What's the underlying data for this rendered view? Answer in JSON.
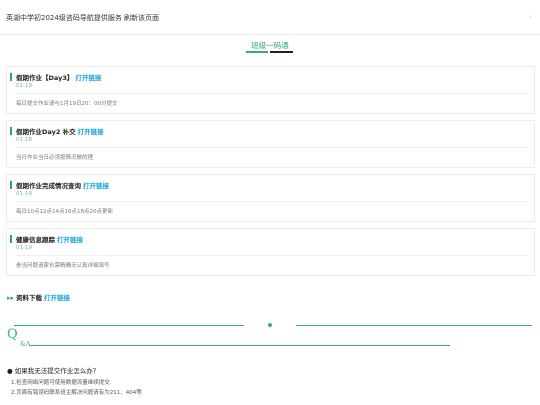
{
  "notice": {
    "text": "英湖中学初2024级咨码导航提供服务 刷新该页面",
    "arrow_icon": "chevron-right-icon"
  },
  "tabs": {
    "title": "班级一码通"
  },
  "cards": [
    {
      "title": "假期作业【Day3】",
      "link": "打开链接",
      "date": "01-19",
      "desc": "每日提交作业请与1月19日20：00分提交"
    },
    {
      "title": "假期作业Day2 补交",
      "link": "打开链接",
      "date": "01-18",
      "desc": "当日作业当日必须按情况做的理"
    },
    {
      "title": "假期作业完成情况查询",
      "link": "打开链接",
      "date": "01-19",
      "desc": "每日10点12点14点16点18点20点更新"
    },
    {
      "title": "健康信息跟踪",
      "link": "打开链接",
      "date": "01-19",
      "desc": "参当问题请家长需精确天认真详细填写"
    }
  ],
  "download": {
    "label": "资料下载",
    "link": "打开链接",
    "icon": "double-chevron-right-icon"
  },
  "qa": {
    "q_letter": "Q",
    "amp_a": "&A"
  },
  "faq": {
    "question": "如果我无法提交作业怎么办？",
    "answers": [
      "1.检查网络问题可使用数据流量继续提交.",
      "2.页面有错误码联系班主解决问题请有为211、404等."
    ]
  },
  "colors": {
    "accent_green": "#2aa56a",
    "link_blue": "#1aa1d9"
  }
}
